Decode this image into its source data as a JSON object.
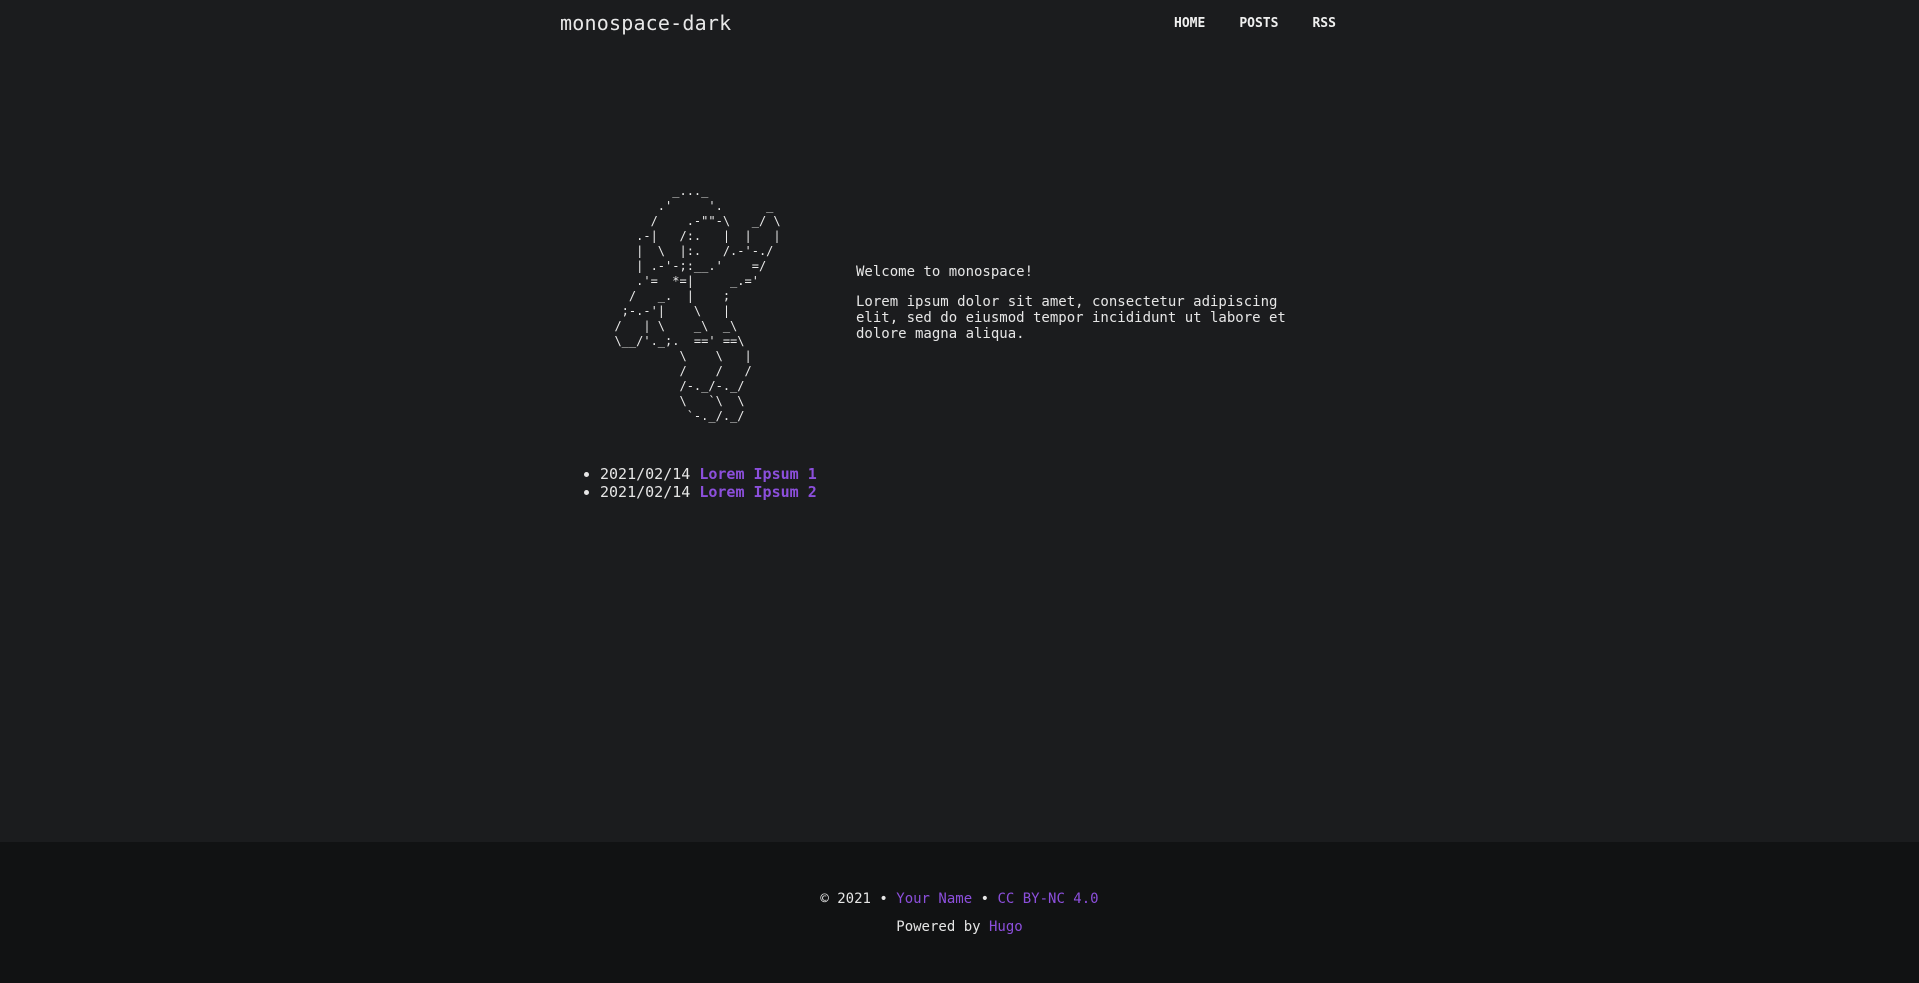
{
  "header": {
    "site_title": "monospace-dark",
    "nav": [
      {
        "label": "HOME"
      },
      {
        "label": "POSTS"
      },
      {
        "label": "RSS"
      }
    ]
  },
  "hero": {
    "ascii_art": "          _..._\n        .'     '.      _\n       /    .-\"\"-\\   _/ \\\n     .-|   /:.   |  |   |\n     |  \\  |:.   /.-'-./\n     | .-'-;:__.'    =/\n     .'=  *=|     _.='\n    /   _.  |    ;\n   ;-.-'|    \\   |\n  /   | \\    _\\  _\\\n  \\__/'._;.  ==' ==\\\n           \\    \\   |\n           /    /   /\n           /-._/-._/\n           \\   `\\  \\\n            `-._/._/",
    "welcome": "Welcome to monospace!",
    "intro": "Lorem ipsum dolor sit amet, consectetur adipiscing elit, sed do eiusmod tempor incididunt ut labore et dolore magna aliqua."
  },
  "posts": [
    {
      "date": "2021/02/14",
      "title": "Lorem Ipsum 1"
    },
    {
      "date": "2021/02/14",
      "title": "Lorem Ipsum 2"
    }
  ],
  "footer": {
    "copyright": "© 2021 •",
    "author": "Your Name",
    "separator": "•",
    "license": "CC BY-NC 4.0",
    "powered_by": "Powered by",
    "engine": "Hugo"
  },
  "colors": {
    "background": "#1b1c1e",
    "footer_background": "#111213",
    "accent": "#8c4fdc",
    "text": "#e6e6e6"
  }
}
